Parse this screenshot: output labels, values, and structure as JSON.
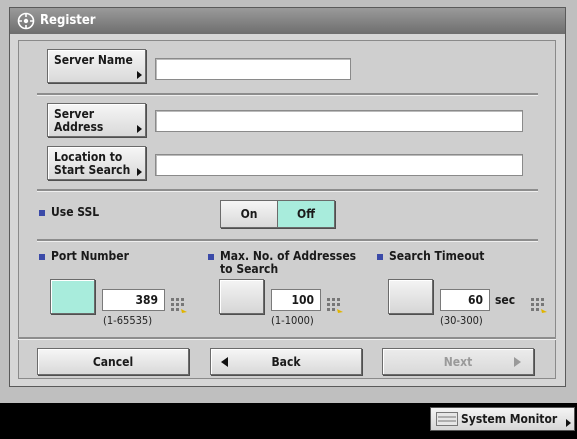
{
  "window": {
    "title": "Register"
  },
  "server_name": {
    "label": "Server Name",
    "value": ""
  },
  "server_address": {
    "label_line1": "Server",
    "label_line2": "Address",
    "value": ""
  },
  "location": {
    "label_line1": "Location to",
    "label_line2": "Start Search",
    "value": ""
  },
  "ssl": {
    "label": "Use SSL",
    "on_label": "On",
    "off_label": "Off",
    "selected": "Off"
  },
  "port": {
    "label": "Port Number",
    "value": "389",
    "range": "(1-65535)"
  },
  "max_addresses": {
    "label_line1": "Max. No. of Addresses",
    "label_line2": "to Search",
    "value": "100",
    "range": "(1-1000)"
  },
  "timeout": {
    "label": "Search Timeout",
    "value": "60",
    "unit": "sec",
    "range": "(30-300)"
  },
  "buttons": {
    "cancel": "Cancel",
    "back": "Back",
    "next": "Next"
  },
  "footer": {
    "system_monitor": "System Monitor"
  },
  "colors": {
    "accent": "#a8ecdc",
    "bullet": "#3b4aa8"
  }
}
